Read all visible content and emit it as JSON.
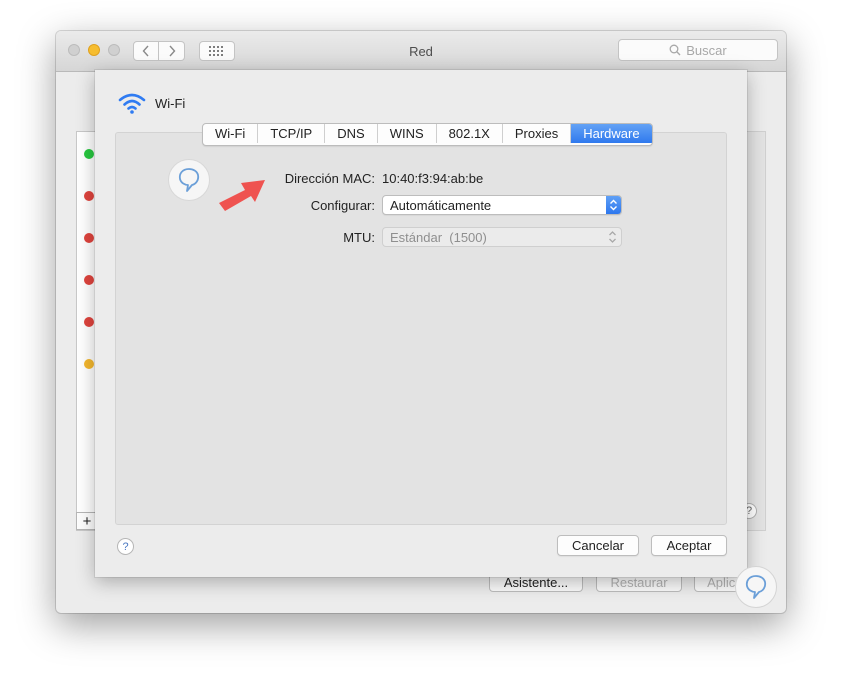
{
  "window": {
    "title": "Red",
    "search_placeholder": "Buscar",
    "background_buttons": {
      "assistant": "Asistente...",
      "restore": "Restaurar",
      "apply": "Aplicar"
    },
    "service_status_colors": [
      "#28c840",
      "#e0443e",
      "#e0443e",
      "#e0443e",
      "#e0443e",
      "#f5b82e"
    ]
  },
  "sheet": {
    "interface_name": "Wi-Fi",
    "tabs": [
      {
        "label": "Wi-Fi"
      },
      {
        "label": "TCP/IP"
      },
      {
        "label": "DNS"
      },
      {
        "label": "WINS"
      },
      {
        "label": "802.1X"
      },
      {
        "label": "Proxies"
      },
      {
        "label": "Hardware",
        "active": true
      }
    ],
    "mac_label": "Dirección MAC:",
    "mac_value": "10:40:f3:94:ab:be",
    "configure_label": "Configurar:",
    "configure_value": "Automáticamente",
    "mtu_label": "MTU:",
    "mtu_value": "Estándar  (1500)",
    "cancel_label": "Cancelar",
    "accept_label": "Aceptar",
    "help_label": "?"
  },
  "colors": {
    "accent": "#3b86f0",
    "arrow": "#ef5350",
    "wifi_icon": "#2f7bf2"
  }
}
